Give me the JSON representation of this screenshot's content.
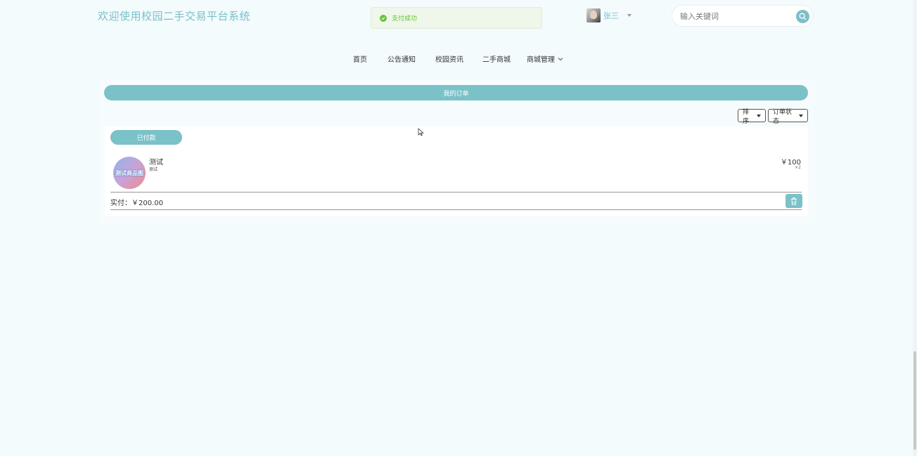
{
  "site_title": "欢迎使用校园二手交易平台系统",
  "toast": {
    "message": "支付成功",
    "icon": "check-circle-icon",
    "color": "#67c23a"
  },
  "user": {
    "name": "张三"
  },
  "search": {
    "placeholder": "输入关键词",
    "icon": "search-icon"
  },
  "nav": {
    "items": [
      "首页",
      "公告通知",
      "校园资讯",
      "二手商城"
    ],
    "dropdown_label": "商城管理"
  },
  "orders": {
    "title": "我的订单",
    "sort_label": "排序",
    "status_filter_label": "订单状态",
    "list": [
      {
        "status": "已付款",
        "product_image_text": "测试商品图",
        "product_name": "测试",
        "product_desc": "测试",
        "price": "￥100",
        "quantity": "×2",
        "paid_label": "实付：￥200.00"
      }
    ]
  },
  "colors": {
    "accent": "#7bc1c8",
    "background": "#f3fbfd",
    "title": "#7bbfc9"
  }
}
